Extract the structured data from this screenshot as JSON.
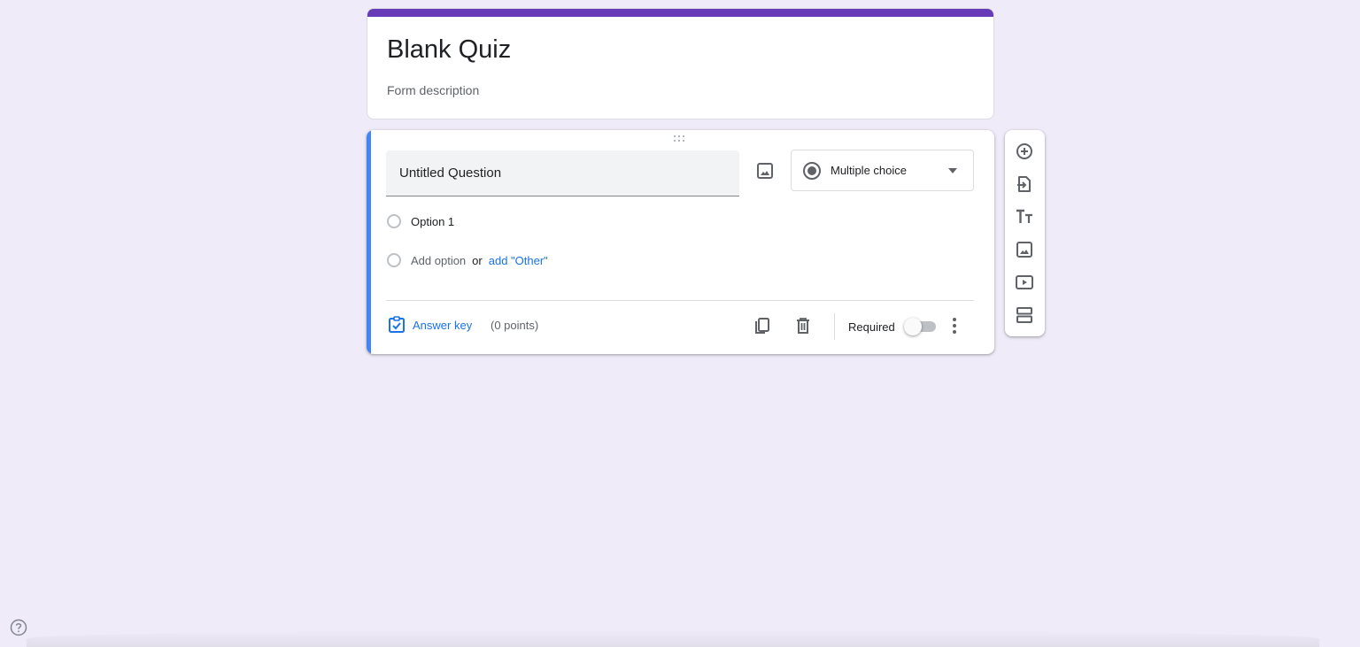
{
  "form": {
    "title": "Blank Quiz",
    "description": "Form description",
    "accent_color": "#673ab7"
  },
  "question": {
    "title": "Untitled Question",
    "type_label": "Multiple choice",
    "options": [
      {
        "label": "Option 1"
      }
    ],
    "add_option": "Add option",
    "or": "or",
    "add_other": "add \"Other\"",
    "answer_key": "Answer key",
    "points": "(0 points)",
    "required_label": "Required",
    "required": false,
    "accent_color": "#4285f4"
  },
  "toolbar": {
    "items": [
      "add-question-icon",
      "import-questions-icon",
      "add-title-description-icon",
      "add-image-icon",
      "add-video-icon",
      "add-section-icon"
    ]
  }
}
